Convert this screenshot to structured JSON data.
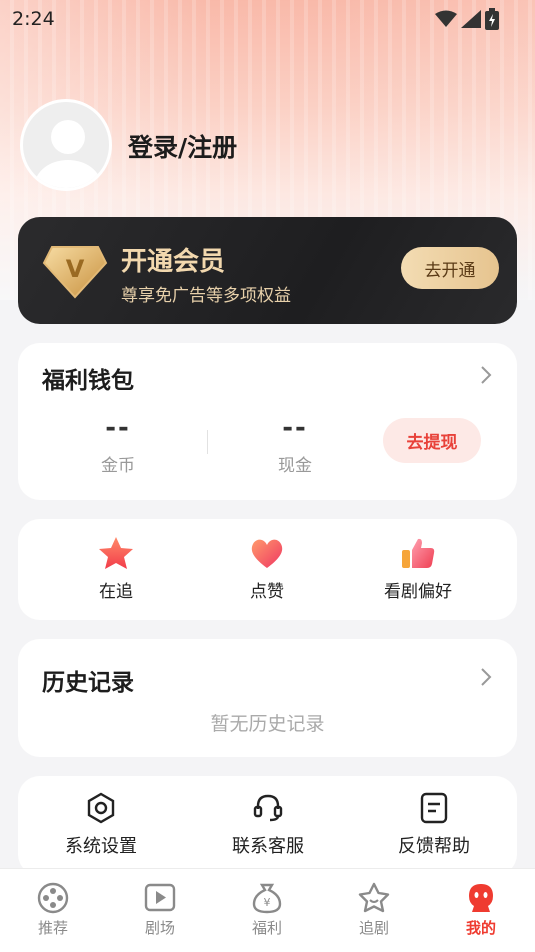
{
  "status_bar": {
    "time": "2:24",
    "icons": [
      "wifi-icon",
      "signal-icon",
      "battery-charging-icon"
    ]
  },
  "profile": {
    "login_label": "登录/注册"
  },
  "vip": {
    "title": "开通会员",
    "subtitle": "尊享免广告等多项权益",
    "button_label": "去开通",
    "badge_letter": "V",
    "colors": {
      "card": "#1e1e20",
      "gold": "#f2d8ae"
    }
  },
  "wallet": {
    "title": "福利钱包",
    "coins": {
      "value": "--",
      "label": "金币"
    },
    "cash": {
      "value": "--",
      "label": "现金"
    },
    "withdraw_label": "去提现",
    "accent": "#ef3b30"
  },
  "quick_actions": [
    {
      "label": "在追",
      "icon": "star-icon"
    },
    {
      "label": "点赞",
      "icon": "heart-icon"
    },
    {
      "label": "看剧偏好",
      "icon": "thumbs-up-icon"
    }
  ],
  "history": {
    "title": "历史记录",
    "empty_text": "暂无历史记录"
  },
  "tools": [
    {
      "label": "系统设置",
      "icon": "settings-hexagon-icon"
    },
    {
      "label": "联系客服",
      "icon": "headset-icon"
    },
    {
      "label": "反馈帮助",
      "icon": "document-icon"
    }
  ],
  "tabs": [
    {
      "label": "推荐",
      "icon": "film-reel-icon",
      "active": false
    },
    {
      "label": "剧场",
      "icon": "play-icon",
      "active": false
    },
    {
      "label": "福利",
      "icon": "money-bag-icon",
      "active": false
    },
    {
      "label": "追剧",
      "icon": "star-outline-icon",
      "active": false
    },
    {
      "label": "我的",
      "icon": "mascot-icon",
      "active": true
    }
  ]
}
